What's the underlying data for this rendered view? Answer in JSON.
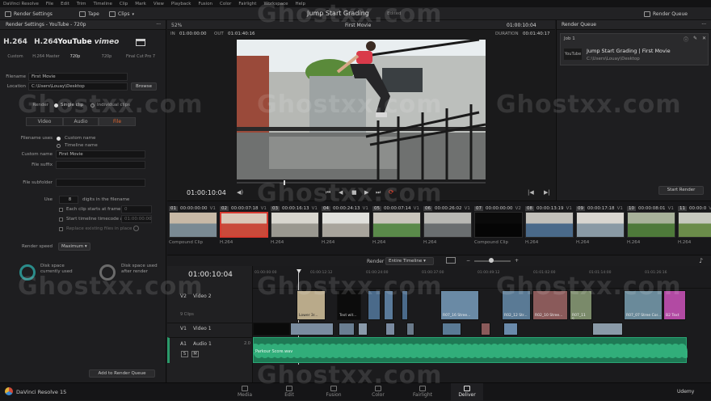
{
  "menu": [
    "DaVinci Resolve",
    "File",
    "Edit",
    "Trim",
    "Timeline",
    "Clip",
    "Mark",
    "View",
    "Playback",
    "Fusion",
    "Color",
    "Fairlight",
    "Workspace",
    "Help"
  ],
  "toolbar": {
    "render_settings": "Render Settings",
    "tape": "Tape",
    "clips": "Clips",
    "project_title": "Jump Start Grading",
    "project_status": "Edited",
    "render_queue": "Render Queue"
  },
  "render_settings": {
    "title": "Render Settings - YouTube - 720p",
    "presets": [
      {
        "logo": "H.264",
        "label": "Custom"
      },
      {
        "logo": "H.264",
        "label": "H.264 Master"
      },
      {
        "logo": "YouTube",
        "label": "720p"
      },
      {
        "logo": "vimeo",
        "label": "720p"
      },
      {
        "logo": "FCP",
        "label": "Final Cut Pro 7"
      }
    ],
    "filename_label": "Filename",
    "filename": "First Movie",
    "location_label": "Location",
    "location": "C:\\Users\\Louay\\Desktop",
    "browse": "Browse",
    "render_label": "Render",
    "single_clip": "Single clip",
    "individual_clips": "Individual clips",
    "tabs": [
      "Video",
      "Audio",
      "File"
    ],
    "filename_uses_label": "Filename uses",
    "custom_name_opt": "Custom name",
    "timeline_name_opt": "Timeline name",
    "custom_name_label": "Custom name",
    "custom_name": "First Movie",
    "file_suffix_label": "File suffix",
    "file_subfolder_label": "File subfolder",
    "use_label": "Use",
    "digits": "8",
    "digits_label": "digits in the filename",
    "each_clip_label": "Each clip starts at frame",
    "each_clip_value": "0",
    "start_tc_label": "Start timeline timecode at",
    "start_tc_value": "01:00:00:00",
    "replace_label": "Replace existing files in place",
    "render_speed_label": "Render speed",
    "render_speed": "Maximum",
    "disk_used_label": "Disk space currently used",
    "disk_after_label": "Disk space used after render",
    "add_to_queue": "Add to Render Queue"
  },
  "viewer": {
    "zoom": "52%",
    "timeline_name": "First Movie",
    "timecode_top": "01:00:10:04",
    "in_label": "IN",
    "in_tc": "01:00:00:00",
    "out_label": "OUT",
    "out_tc": "01:01:40:16",
    "duration_label": "DURATION",
    "duration": "00:01:40:17",
    "playhead_tc": "01:00:10:04"
  },
  "render_queue": {
    "title": "Render Queue",
    "job_label": "Job 1",
    "job_title": "Jump Start Grading | First Movie",
    "job_path": "C:\\Users\\Louay\\Desktop",
    "start_render": "Start Render"
  },
  "clips": [
    {
      "n": "01",
      "tc": "00:00:00:00",
      "track": "V1",
      "codec": "Compound Clip",
      "c1": "#7a8a93",
      "c2": "#c8b9a6"
    },
    {
      "n": "02",
      "tc": "00:00:07:18",
      "track": "V1",
      "codec": "H.264",
      "c1": "#c94a3a",
      "c2": "#d9c8b8"
    },
    {
      "n": "03",
      "tc": "00:00:16:13",
      "track": "V1",
      "codec": "H.264",
      "c1": "#9a9890",
      "c2": "#d8d6cf"
    },
    {
      "n": "04",
      "tc": "00:00:24:13",
      "track": "V1",
      "codec": "H.264",
      "c1": "#a8a49c",
      "c2": "#e0e0dc"
    },
    {
      "n": "05",
      "tc": "00:00:07:14",
      "track": "V1",
      "codec": "H.264",
      "c1": "#5a8a4a",
      "c2": "#c9c5bc"
    },
    {
      "n": "06",
      "tc": "00:00:26:02",
      "track": "V1",
      "codec": "H.264",
      "c1": "#6a6e70",
      "c2": "#b8b8b4"
    },
    {
      "n": "07",
      "tc": "00:00:00:00",
      "track": "V2",
      "codec": "Compound Clip",
      "c1": "#050505",
      "c2": "#0a0a0a"
    },
    {
      "n": "08",
      "tc": "00:00:13:19",
      "track": "V1",
      "codec": "H.264",
      "c1": "#4a6a8a",
      "c2": "#c2c0ba"
    },
    {
      "n": "09",
      "tc": "00:00:17:18",
      "track": "V1",
      "codec": "H.264",
      "c1": "#8a9aa5",
      "c2": "#d9d6d0"
    },
    {
      "n": "10",
      "tc": "00:00:08:01",
      "track": "V1",
      "codec": "H.264",
      "c1": "#4e7a3a",
      "c2": "#a8b29a"
    },
    {
      "n": "11",
      "tc": "00:00:0",
      "track": "V1",
      "codec": "H.264",
      "c1": "#6b8c4a",
      "c2": "#c7c9bf"
    }
  ],
  "timeline": {
    "render_label": "Render",
    "render_mode": "Entire Timeline",
    "timecode": "01:00:10:04",
    "ruler": [
      "01:00:00:00",
      "01:00:12:12",
      "01:00:24:00",
      "01:00:37:00",
      "01:00:49:12",
      "01:01:02:00",
      "01:01:14:00",
      "01:01:26:16"
    ],
    "tracks": [
      {
        "id": "V2",
        "name": "Video 2",
        "count": "9 Clips"
      },
      {
        "id": "V1",
        "name": "Video 1",
        "count": ""
      },
      {
        "id": "A1",
        "name": "Audio 1",
        "level": "2.0"
      }
    ],
    "clip_labels": [
      "Lower 3r...",
      "Text wit...",
      "R07_16 Stree...",
      "R02_12 Str...",
      "R02_10 Stree...",
      "R07_11 S...",
      "R07_07 Stree Cor...",
      "B2 Text"
    ],
    "audio_clip": "Parkour Score.wav"
  },
  "pages": [
    "Media",
    "Edit",
    "Fusion",
    "Color",
    "Fairlight",
    "Deliver"
  ],
  "active_page": "Deliver",
  "app_name": "DaVinci Resolve 15",
  "watermark": "Ghostxx.com",
  "udemy": "Udemy"
}
